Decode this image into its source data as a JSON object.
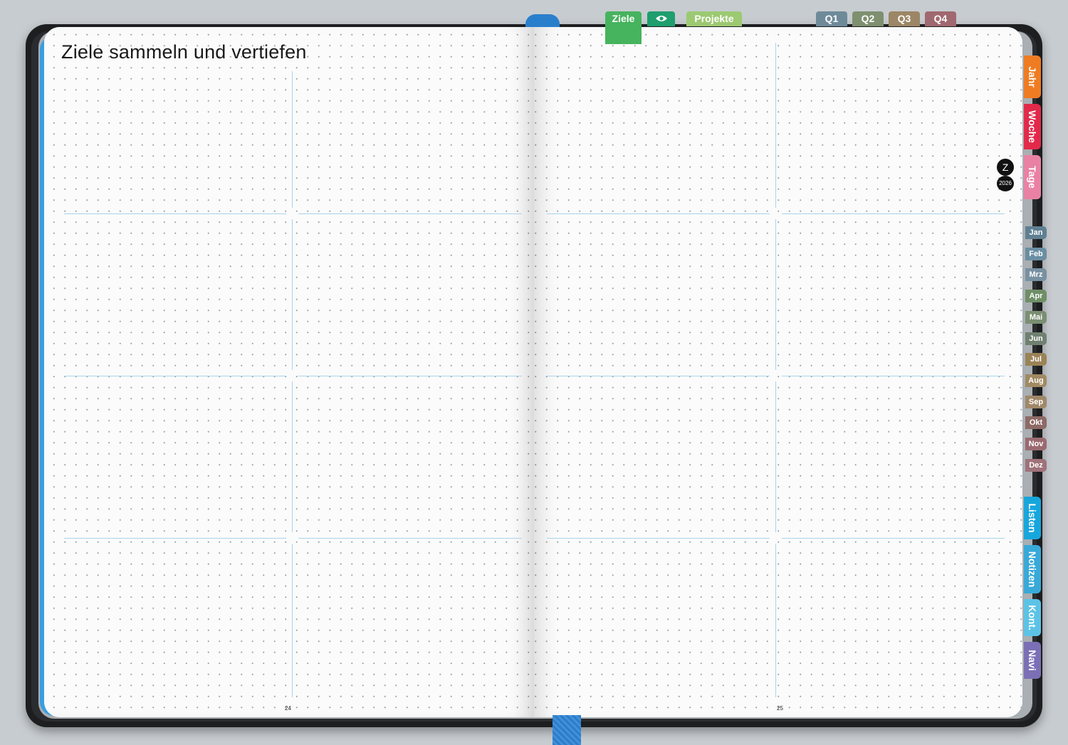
{
  "title": "Ziele sammeln und vertiefen",
  "page_numbers": {
    "left": "24",
    "right": "25"
  },
  "top_tabs": [
    {
      "label": "Ziele",
      "color": "#46b35e"
    },
    {
      "label": "",
      "icon": "eye-icon",
      "color": "#1f9e6e"
    },
    {
      "label": "Projekte",
      "color": "#9cc971"
    },
    {
      "label": "Q1",
      "color": "#6e8a99"
    },
    {
      "label": "Q2",
      "color": "#7e9070"
    },
    {
      "label": "Q3",
      "color": "#9c8665"
    },
    {
      "label": "Q4",
      "color": "#a06870"
    }
  ],
  "side_tabs": [
    {
      "label": "Jahr",
      "color": "#ef7c22"
    },
    {
      "label": "Woche",
      "color": "#e2294a"
    },
    {
      "label": "Tage",
      "color": "#e981a4"
    }
  ],
  "months": [
    {
      "label": "Jan",
      "color": "#5f7f92"
    },
    {
      "label": "Feb",
      "color": "#6a8ea3"
    },
    {
      "label": "Mrz",
      "color": "#7891a2"
    },
    {
      "label": "Apr",
      "color": "#6f8f66"
    },
    {
      "label": "Mai",
      "color": "#7a8f72"
    },
    {
      "label": "Jun",
      "color": "#6f8070"
    },
    {
      "label": "Jul",
      "color": "#9a8356"
    },
    {
      "label": "Aug",
      "color": "#a18a62"
    },
    {
      "label": "Sep",
      "color": "#a08868"
    },
    {
      "label": "Okt",
      "color": "#8e6a66"
    },
    {
      "label": "Nov",
      "color": "#9a6a70"
    },
    {
      "label": "Dez",
      "color": "#a0727a"
    }
  ],
  "bottom_tabs": [
    {
      "label": "Listen",
      "color": "#17a6dc"
    },
    {
      "label": "Notizen",
      "color": "#38a9d8"
    },
    {
      "label": "Kont.",
      "color": "#5cc3e6"
    },
    {
      "label": "Navi",
      "color": "#7b6fb5"
    }
  ],
  "badges": {
    "letter": "Z",
    "year": "2026"
  }
}
